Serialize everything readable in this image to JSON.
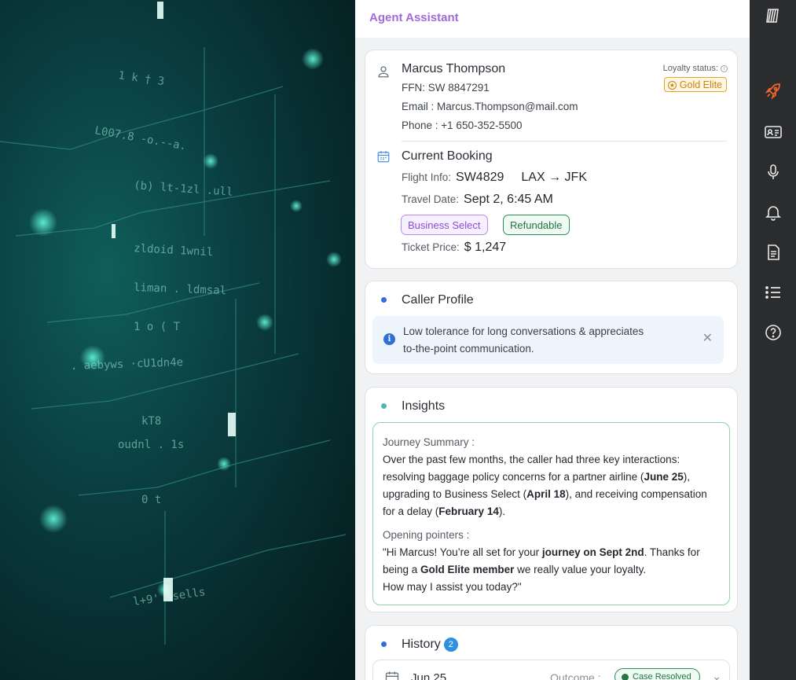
{
  "header": {
    "title": "Agent Assistant"
  },
  "customer": {
    "name": "Marcus Thompson",
    "ffn": "FFN: SW 8847291",
    "email": "Email : Marcus.Thompson@mail.com",
    "phone": "Phone : +1 650-352-5500",
    "loyalty_label": "Loyalty status:",
    "loyalty_value": "Gold Elite",
    "icons": {
      "person": "person-icon",
      "info": "info-circle-icon",
      "star": "star-circle-icon"
    }
  },
  "booking": {
    "title": "Current Booking",
    "flight_label": "Flight Info:",
    "flight_number": "SW4829",
    "route": "LAX → JFK",
    "date_label": "Travel Date:",
    "date_value": "Sept 2, 6:45 AM",
    "tags": [
      "Business Select",
      "Refundable"
    ],
    "price_label": "Ticket Price:",
    "price_value": "$ 1,247"
  },
  "caller_profile": {
    "title": "Caller Profile",
    "note_line1": "Low tolerance for long conversations  & appreciates",
    "note_line2": "to-the-point communication.",
    "dot_color": "#2f6fd6"
  },
  "insights": {
    "title": "Insights",
    "journey_label": "Journey Summary :",
    "journey": {
      "p1": "Over the past few months, the caller had three key interactions: resolving baggage policy concerns for a partner airline (",
      "b1": "June 25",
      "p2": "), upgrading to Business Select (",
      "b2": "April 18",
      "p3": "), and receiving compensation for a delay (",
      "b3": "February 14",
      "p4": ")."
    },
    "opening_label": "Opening pointers :",
    "opening": {
      "p1": "\"Hi Marcus! You’re all set for your ",
      "b1": "journey on Sept 2nd",
      "p2": ". Thanks for being a ",
      "b2": "Gold Elite member",
      "p3": " we really value your loyalty.",
      "line3": "How may I assist you today?\""
    },
    "dot_color": "#4fb8a8"
  },
  "history": {
    "title": "History",
    "count": "2",
    "rows": [
      {
        "date": "Jun 25",
        "outcome_label": "Outcome :",
        "outcome": "Case Resolved"
      }
    ],
    "dot_color": "#2f6fd6"
  },
  "rail": {
    "items": [
      "logo-icon",
      "rocket-icon",
      "contact-card-icon",
      "microphone-icon",
      "bell-icon",
      "document-icon",
      "list-icon",
      "help-icon"
    ],
    "active_color": "#f0652f"
  }
}
